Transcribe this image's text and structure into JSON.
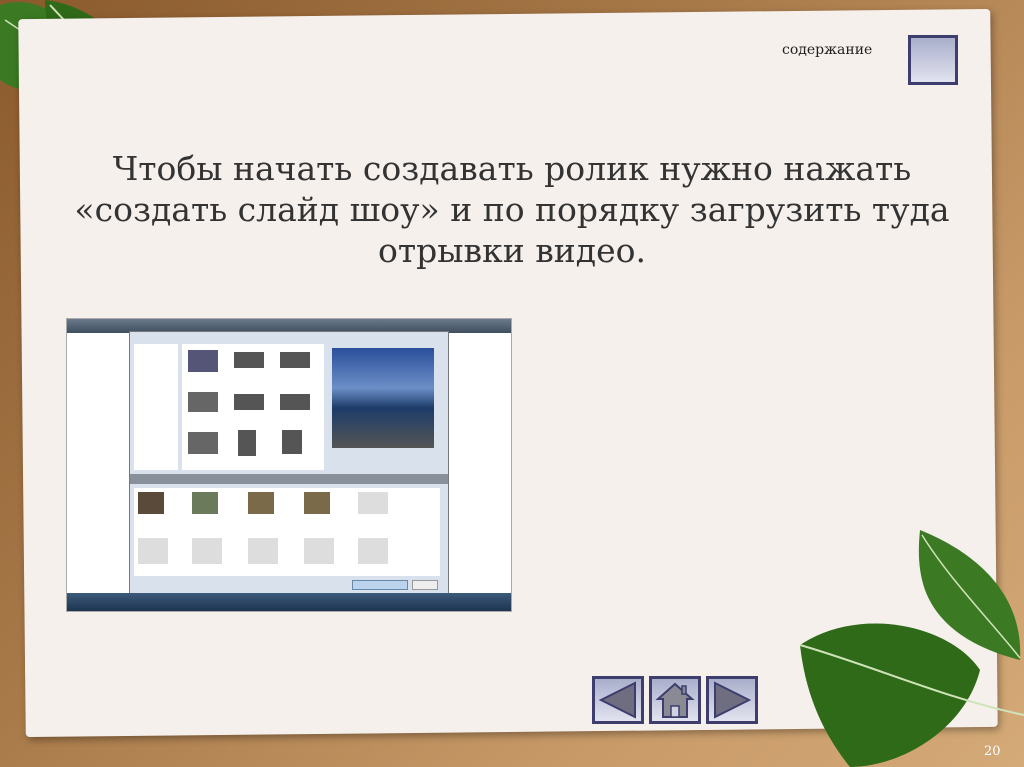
{
  "header": {
    "contents_label": "содержание",
    "contents_button": "contents-button"
  },
  "slide": {
    "title": "Чтобы начать создавать ролик нужно нажать «создать слайд шоу» и по порядку загрузить туда отрывки видео.",
    "page_number": "20"
  },
  "nav": {
    "prev": "previous-slide",
    "home": "home",
    "next": "next-slide"
  },
  "colors": {
    "leaf": "#2f6a18",
    "button_border": "#3e3e6e",
    "paper": "#f6f0ec"
  }
}
